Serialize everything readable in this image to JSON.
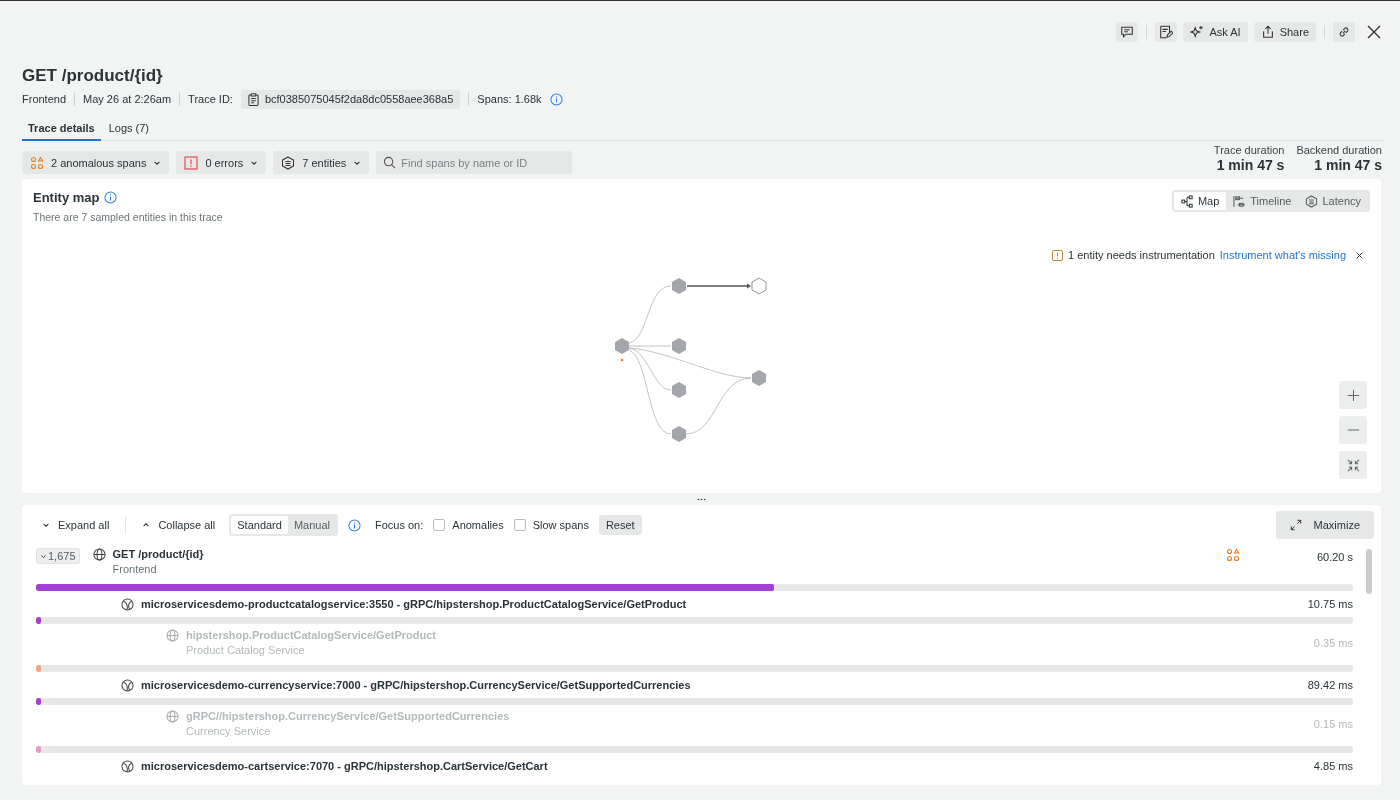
{
  "toolbar": {
    "buttons": [
      {
        "kind": "comment"
      },
      {
        "kind": "notes"
      },
      {
        "kind": "ai",
        "label": "Ask AI"
      },
      {
        "kind": "share",
        "label": "Share"
      },
      {
        "kind": "link"
      }
    ]
  },
  "title": "GET /product/{id}",
  "meta": {
    "service": "Frontend",
    "date": "May 26 at 2:26am",
    "trace_id_label": "Trace ID:",
    "trace_id": "bcf0385075045f2da8dc0558aee368a5",
    "spans": "Spans: 1.68k"
  },
  "tabs": [
    {
      "label": "Trace details",
      "selected": true
    },
    {
      "label": "Logs (7)",
      "selected": false
    }
  ],
  "filters": [
    {
      "kind": "anomaly",
      "label": "2 anomalous spans"
    },
    {
      "kind": "error",
      "label": "0 errors"
    },
    {
      "kind": "entity",
      "label": "7 entities"
    }
  ],
  "search": {
    "placeholder": "Find spans by name or ID"
  },
  "durations": [
    {
      "label": "Trace duration",
      "value": "1 min 47 s"
    },
    {
      "label": "Backend duration",
      "value": "1 min 47 s"
    }
  ],
  "entity_map": {
    "title": "Entity map",
    "subtitle": "There are 7 sampled entities in this trace",
    "views": [
      {
        "kind": "map",
        "label": "Map",
        "selected": true
      },
      {
        "kind": "timeline",
        "label": "Timeline",
        "selected": false
      },
      {
        "kind": "latency",
        "label": "Latency",
        "selected": false
      }
    ],
    "notice": {
      "text": "1 entity needs instrumentation",
      "link": "Instrument what's missing"
    }
  },
  "span_toolbar": {
    "expand": "Expand all",
    "collapse": "Collapse all",
    "modes": [
      {
        "label": "Standard",
        "selected": true
      },
      {
        "label": "Manual",
        "selected": false
      }
    ],
    "focus_label": "Focus on:",
    "focus": [
      {
        "label": "Anomalies",
        "checked": false
      },
      {
        "label": "Slow spans",
        "checked": false
      }
    ],
    "reset": "Reset",
    "maximize": "Maximize"
  },
  "spans": [
    {
      "kind": "root",
      "count": "1,675",
      "name": "GET /product/{id}",
      "service": "Frontend",
      "duration": "60.20 s",
      "anomalous": true,
      "level": 0.56,
      "color": "#a53fd4"
    },
    {
      "kind": "service",
      "name": "microservicesdemo-productcatalogservice:3550 - gRPC/hipstershop.ProductCatalogService/GetProduct",
      "duration": "10.75 ms",
      "anomalous": false,
      "level": 0.002,
      "color": "#a53fd4"
    },
    {
      "kind": "child",
      "name": "hipstershop.ProductCatalogService/GetProduct",
      "service": "Product Catalog Service",
      "duration": "0.35 ms",
      "anomalous": false,
      "level": 0.001,
      "color": "#f0a48c"
    },
    {
      "kind": "service",
      "name": "microservicesdemo-currencyservice:7000 - gRPC/hipstershop.CurrencyService/GetSupportedCurrencies",
      "duration": "89.42 ms",
      "anomalous": false,
      "level": 0.002,
      "color": "#a53fd4"
    },
    {
      "kind": "child",
      "name": "gRPC//hipstershop.CurrencyService/GetSupportedCurrencies",
      "service": "Currency Service",
      "duration": "0.15 ms",
      "anomalous": false,
      "level": 0.001,
      "color": "#e49ac8"
    },
    {
      "kind": "service",
      "name": "microservicesdemo-cartservice:7070 - gRPC/hipstershop.CartService/GetCart",
      "duration": "4.85 ms",
      "anomalous": false
    }
  ]
}
